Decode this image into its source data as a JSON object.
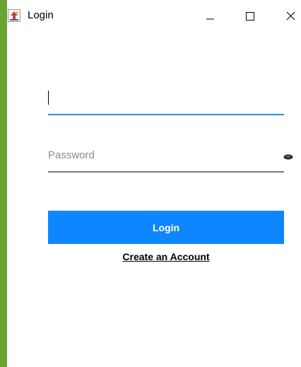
{
  "window": {
    "title": "Login",
    "app_icon": "java-cup-icon",
    "controls": {
      "minimize_icon": "minimize-icon",
      "maximize_icon": "maximize-icon",
      "close_icon": "close-icon"
    }
  },
  "form": {
    "username": {
      "value": "",
      "placeholder": ""
    },
    "password": {
      "value": "",
      "placeholder": "Password",
      "toggle_icon": "eye-icon"
    },
    "login_label": "Login",
    "create_account_label": "Create an Account"
  },
  "colors": {
    "desktop_background": "#6aa532",
    "window_background": "#ffffff",
    "accent": "#0d86ff",
    "focus_underline": "#2a8ff0",
    "inactive_underline": "#7a7a7a",
    "placeholder_text": "#8a8a8a"
  }
}
